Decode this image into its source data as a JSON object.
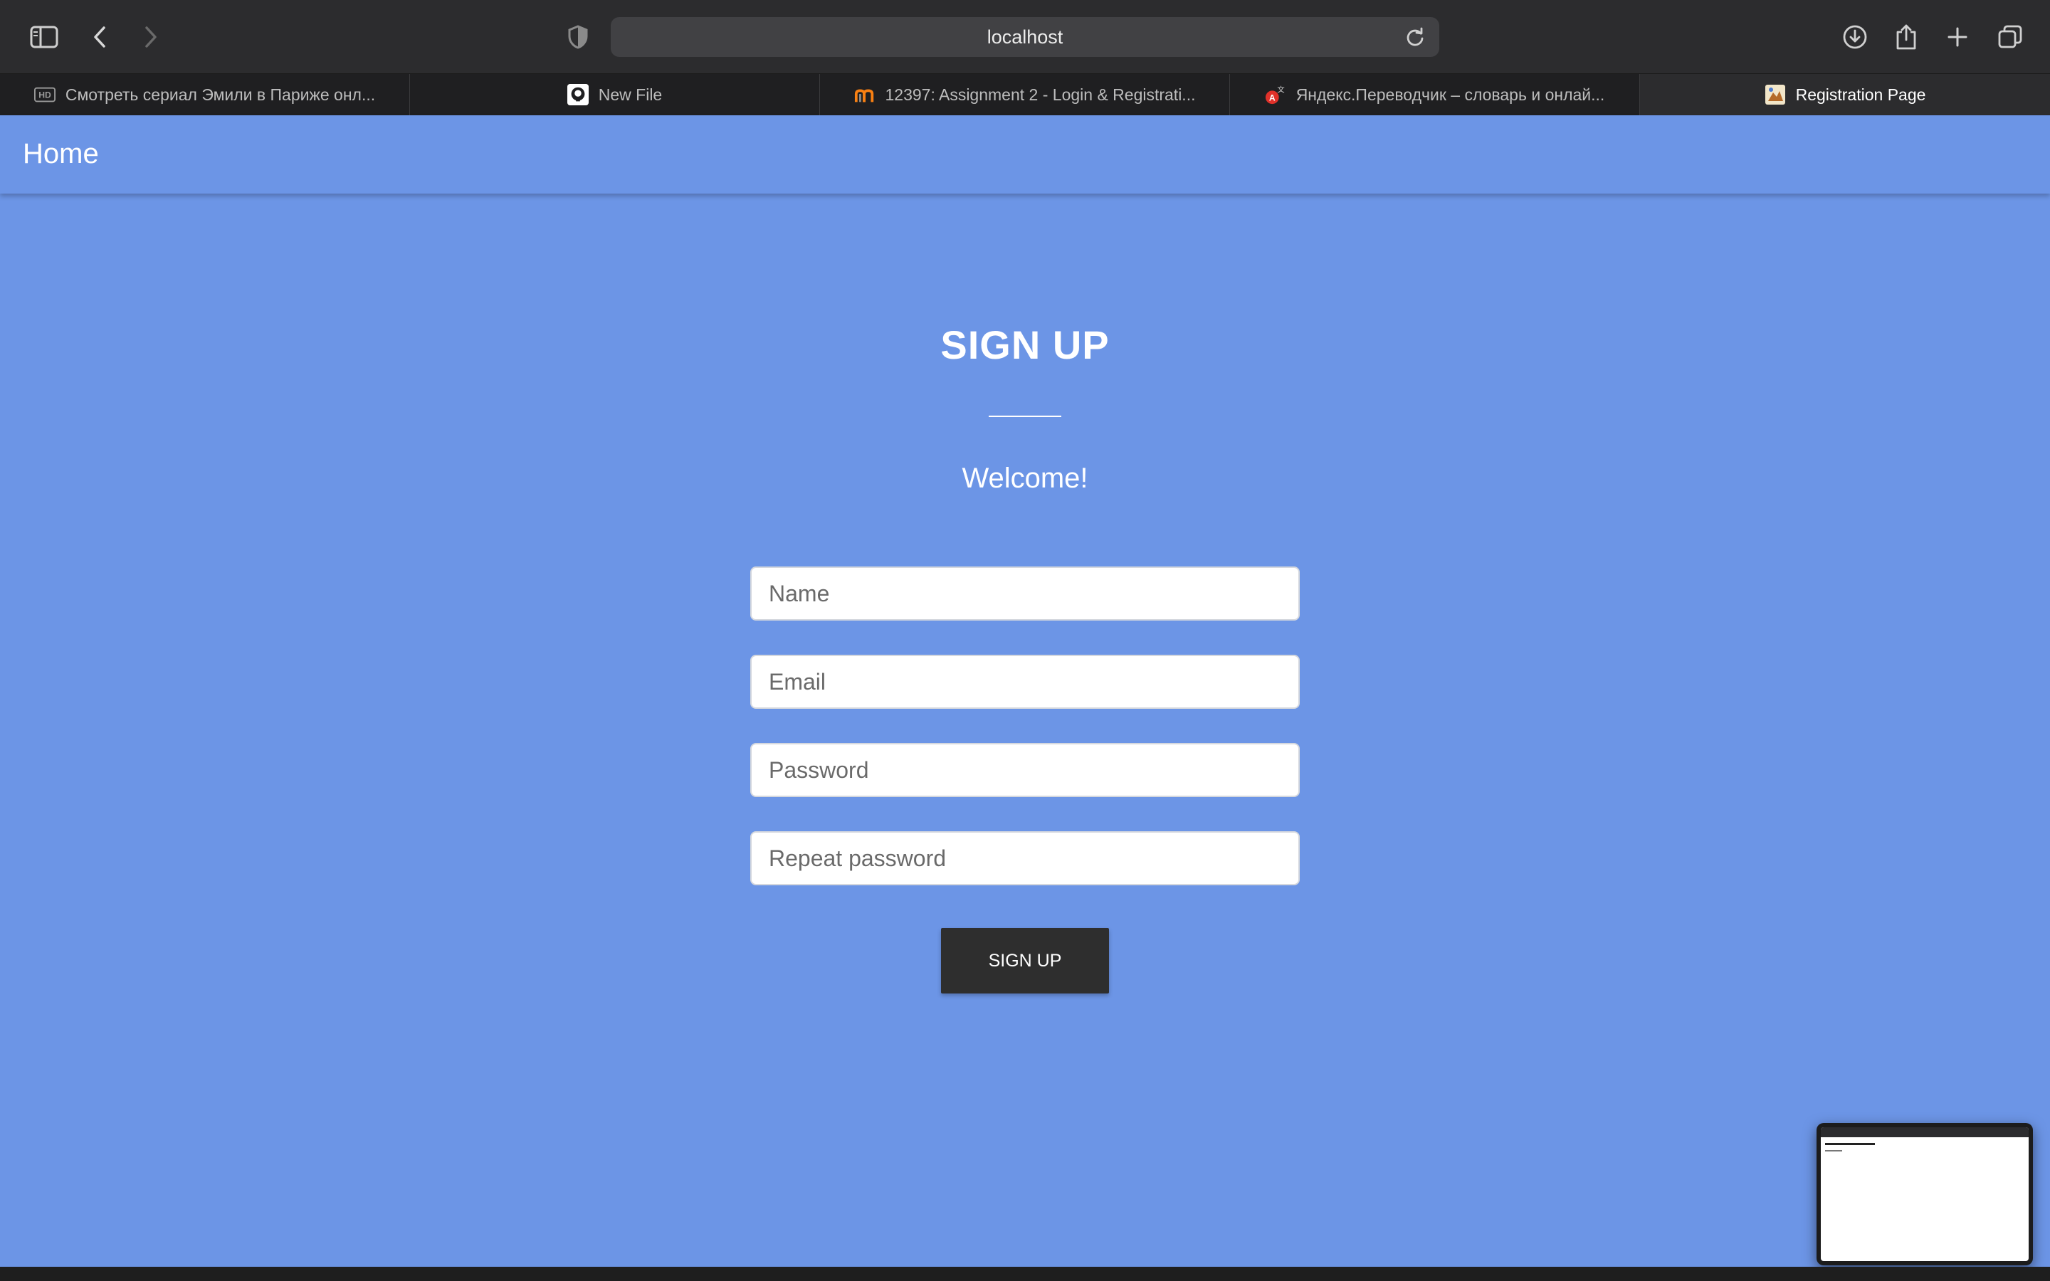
{
  "browser": {
    "url": "localhost",
    "tabs": [
      {
        "label": "Смотреть сериал Эмили в Париже онл...",
        "icon": "hd-icon",
        "active": false
      },
      {
        "label": "New File",
        "icon": "github-icon",
        "active": false
      },
      {
        "label": "12397: Assignment 2 - Login & Registrati...",
        "icon": "moodle-icon",
        "active": false
      },
      {
        "label": "Яндекс.Переводчик – словарь и онлай...",
        "icon": "translate-icon",
        "active": false
      },
      {
        "label": "Registration Page",
        "icon": "page-icon",
        "active": true
      }
    ]
  },
  "navbar": {
    "home_label": "Home"
  },
  "form": {
    "title": "SIGN UP",
    "welcome": "Welcome!",
    "name_placeholder": "Name",
    "email_placeholder": "Email",
    "password_placeholder": "Password",
    "repeat_password_placeholder": "Repeat password",
    "submit_label": "SIGN UP"
  },
  "colors": {
    "page_background": "#6c95e6",
    "button_background": "#2e2e2e",
    "chrome_background": "#2c2c2e"
  }
}
